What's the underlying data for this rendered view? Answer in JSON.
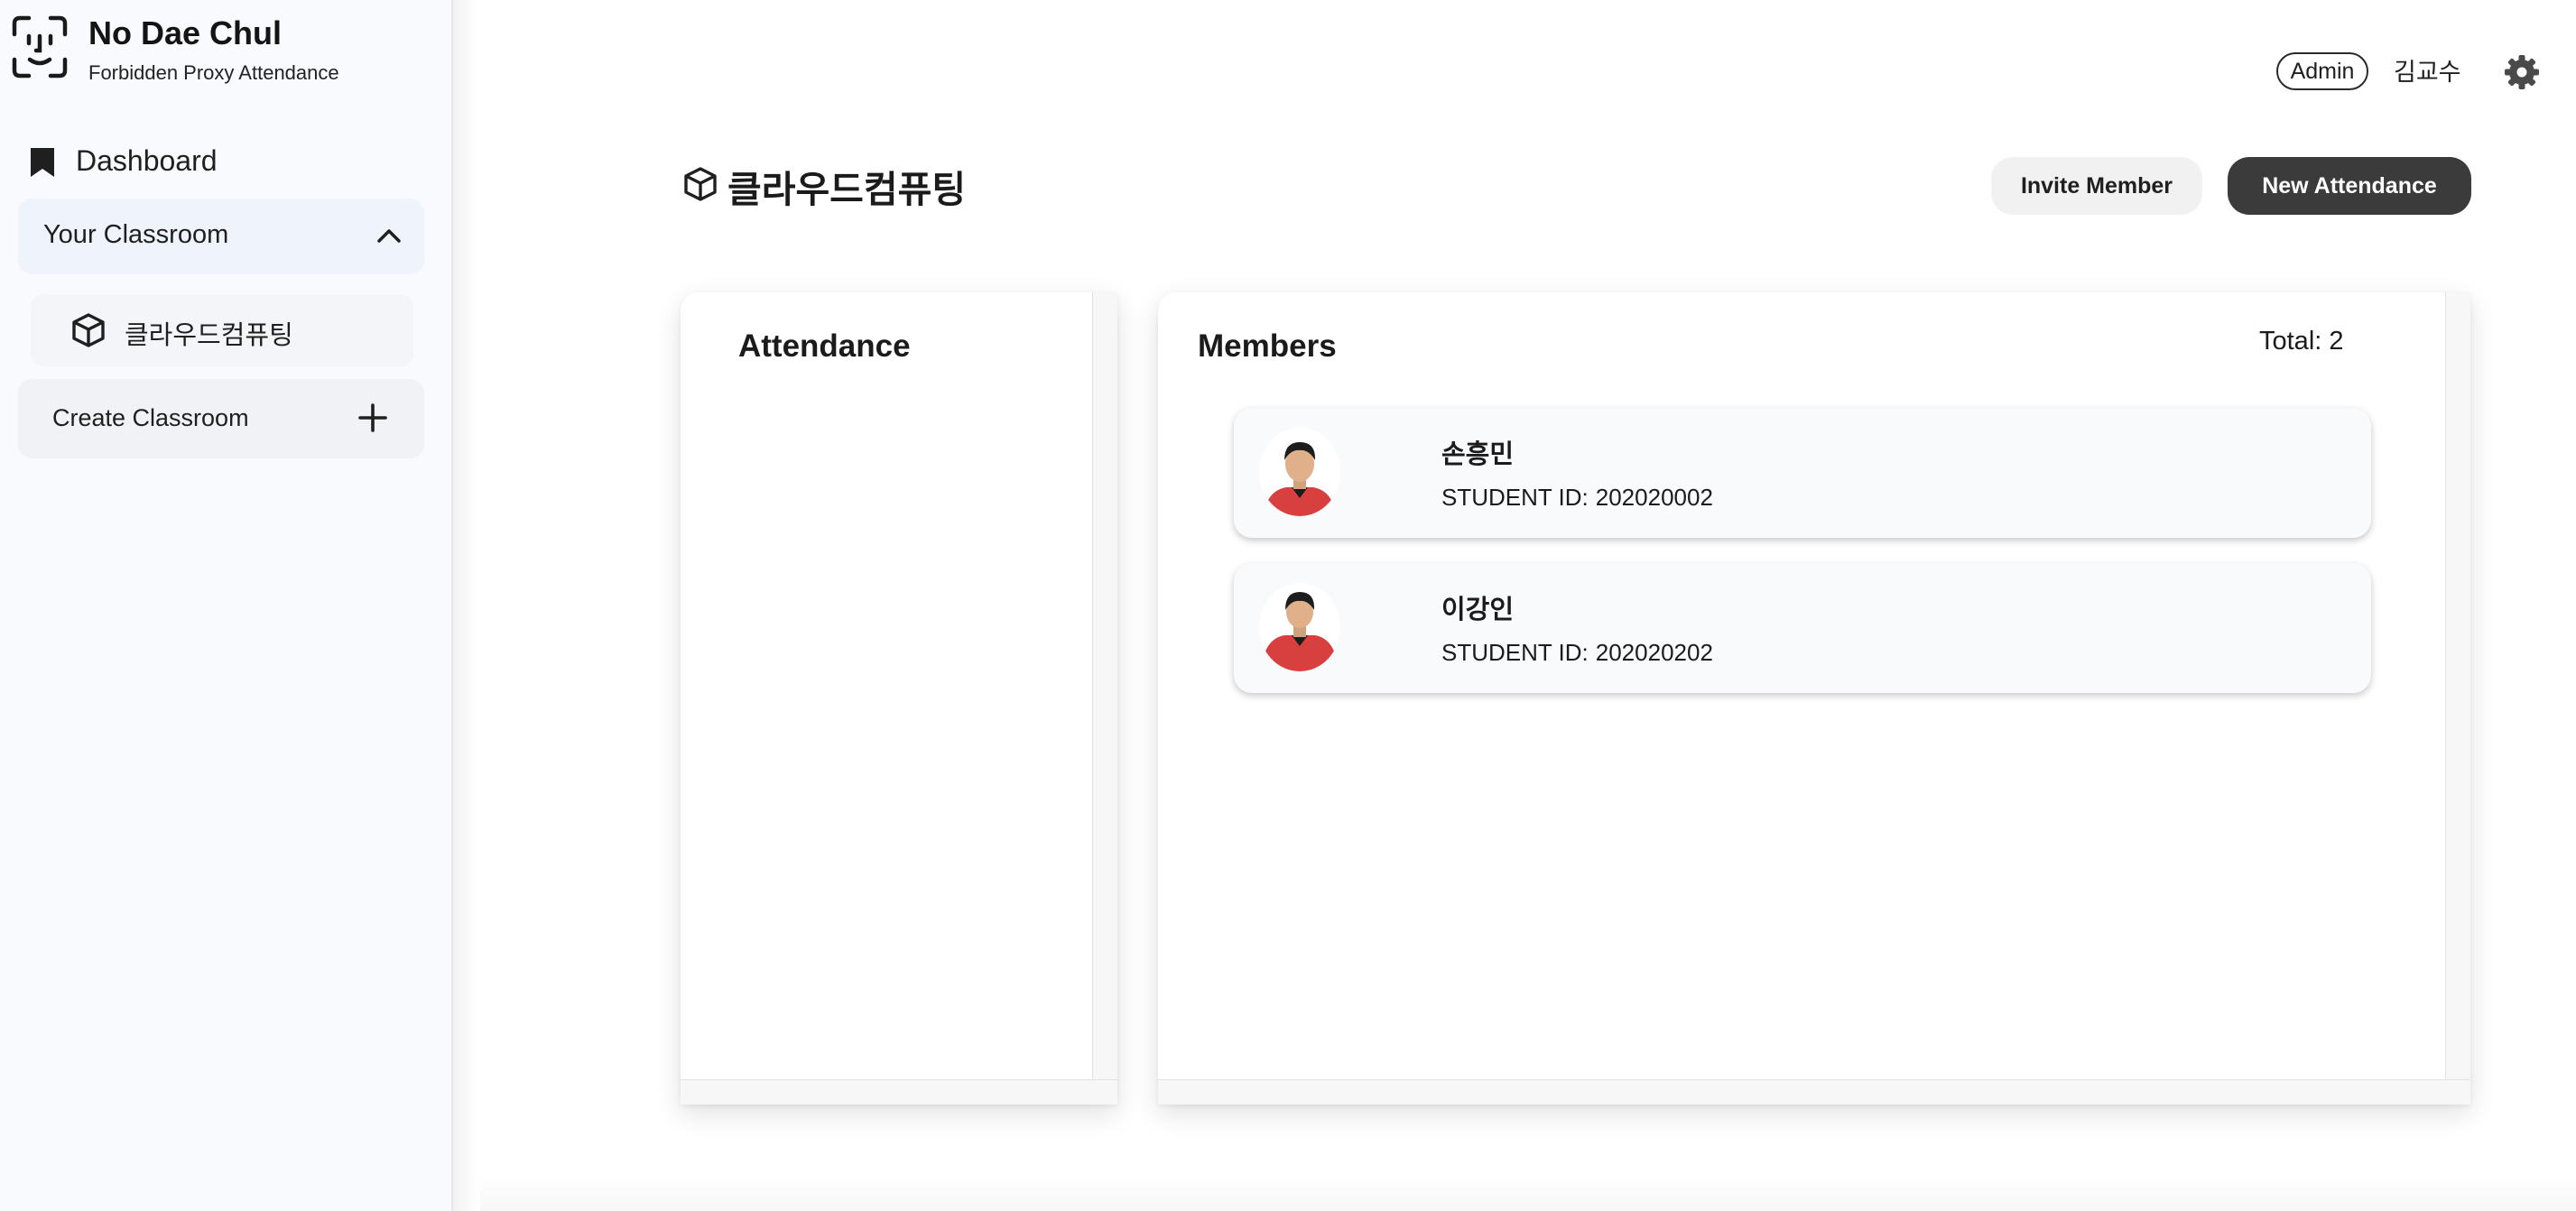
{
  "app": {
    "name": "No Dae Chul",
    "tagline": "Forbidden Proxy Attendance",
    "logo_icon": "face-scan-icon"
  },
  "sidebar": {
    "dashboard_label": "Dashboard",
    "dashboard_icon": "bookmark-icon",
    "group_label": "Your Classroom",
    "group_icon": "chevron-up-icon",
    "classrooms": [
      {
        "label": "클라우드컴퓨팅",
        "icon": "cube-icon"
      }
    ],
    "create_label": "Create Classroom",
    "create_icon": "plus-icon"
  },
  "topbar": {
    "role": "Admin",
    "user": "김교수",
    "settings_icon": "gear-icon"
  },
  "page": {
    "title": "클라우드컴퓨팅",
    "title_icon": "cube-icon",
    "invite_label": "Invite Member",
    "new_attendance_label": "New Attendance"
  },
  "attendance": {
    "title": "Attendance"
  },
  "members": {
    "title": "Members",
    "total_text": "Total: 2",
    "id_label": "STUDENT ID:",
    "items": [
      {
        "name": "손흥민",
        "student_id": "202020002"
      },
      {
        "name": "이강인",
        "student_id": "202020202"
      }
    ]
  },
  "colors": {
    "sidebar_bg": "#f8fafd",
    "group_bg": "#eef3fc",
    "primary_button": "#3b3b3b",
    "secondary_button": "#f1f1f1",
    "jersey_red": "#d8403f"
  }
}
